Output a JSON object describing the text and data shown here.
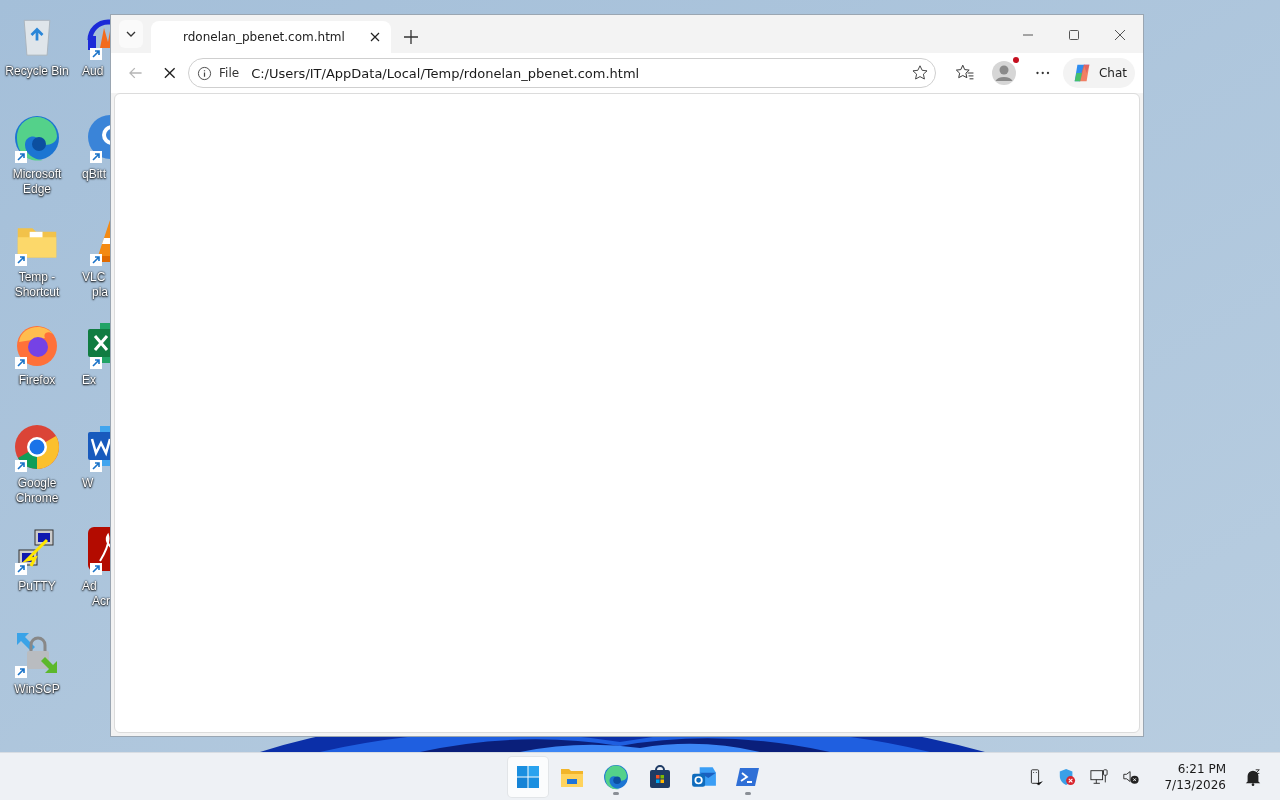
{
  "desktop_icons": [
    {
      "label": "Recycle Bin",
      "kind": "recycle",
      "shortcut": false
    },
    {
      "label": "Microsoft Edge",
      "kind": "edge",
      "shortcut": true
    },
    {
      "label": "Temp - Shortcut",
      "kind": "folder",
      "shortcut": true
    },
    {
      "label": "Firefox",
      "kind": "firefox",
      "shortcut": true
    },
    {
      "label": "Google Chrome",
      "kind": "chrome",
      "shortcut": true
    },
    {
      "label": "PuTTY",
      "kind": "putty",
      "shortcut": true
    },
    {
      "label": "WinSCP",
      "kind": "winscp",
      "shortcut": true
    }
  ],
  "desktop_icons_partial": [
    {
      "label": "Aud",
      "kind": "audio",
      "shortcut": true
    },
    {
      "label": "qBitt",
      "kind": "qbit",
      "shortcut": true
    },
    {
      "label": "VLC",
      "label_2": "pla",
      "kind": "vlc",
      "shortcut": true
    },
    {
      "label": "Ex",
      "kind": "excel",
      "shortcut": true
    },
    {
      "label": "W",
      "kind": "word",
      "shortcut": true
    },
    {
      "label": "Ad",
      "label_2": "Acr",
      "kind": "acrobat",
      "shortcut": true
    }
  ],
  "browser": {
    "tabs": [
      {
        "title": "rdonelan_pbenet.com.html",
        "selected": true
      }
    ],
    "address": {
      "scheme": "File",
      "url": "C:/Users/IT/AppData/Local/Temp/rdonelan_pbenet.com.html"
    },
    "loading": true,
    "back_disabled": true,
    "profile_notification": true,
    "chat": "Chat"
  },
  "taskbar": {
    "apps": [
      {
        "kind": "start",
        "running": false,
        "selected": true
      },
      {
        "kind": "files",
        "running": false,
        "selected": false
      },
      {
        "kind": "edge",
        "running": true,
        "selected": false
      },
      {
        "kind": "store",
        "running": false,
        "selected": false
      },
      {
        "kind": "outlook",
        "running": false,
        "selected": false
      },
      {
        "kind": "terminal",
        "running": true,
        "selected": false
      }
    ],
    "tray": [
      {
        "kind": "usb"
      },
      {
        "kind": "defender"
      },
      {
        "kind": "network"
      },
      {
        "kind": "volume"
      }
    ],
    "time": "6:21 PM",
    "date": "7/13/2026"
  }
}
